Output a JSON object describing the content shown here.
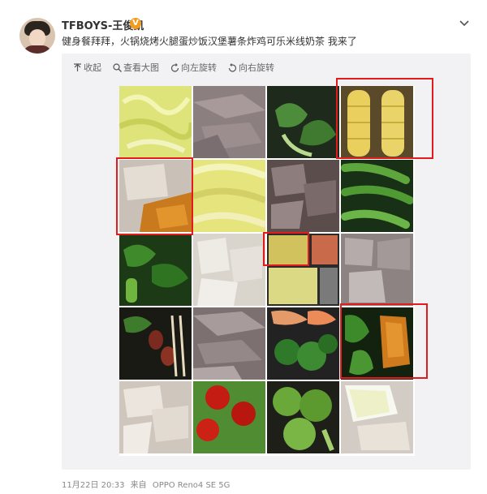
{
  "post": {
    "username": "TFBOYS-王俊凯",
    "verified_badge": "V",
    "text": "健身餐拜拜，火锅烧烤火腿蛋炒饭汉堡薯条炸鸡可乐米线奶茶 我来了",
    "timestamp": "11月22日 20:33",
    "source_label": "来自",
    "source_device": "OPPO Reno4 SE 5G"
  },
  "toolbar": {
    "collapse": "收起",
    "view_large": "查看大图",
    "rotate_left": "向左旋转",
    "rotate_right": "向右旋转"
  },
  "icons": {
    "more": "chevron-down-icon",
    "collapse": "collapse-arrow-icon",
    "view_large": "magnifier-icon",
    "rotate_left": "rotate-left-icon",
    "rotate_right": "rotate-right-icon"
  },
  "photo_grid": {
    "columns": 4,
    "rows": 5,
    "highlight_color": "#e21c1c"
  }
}
